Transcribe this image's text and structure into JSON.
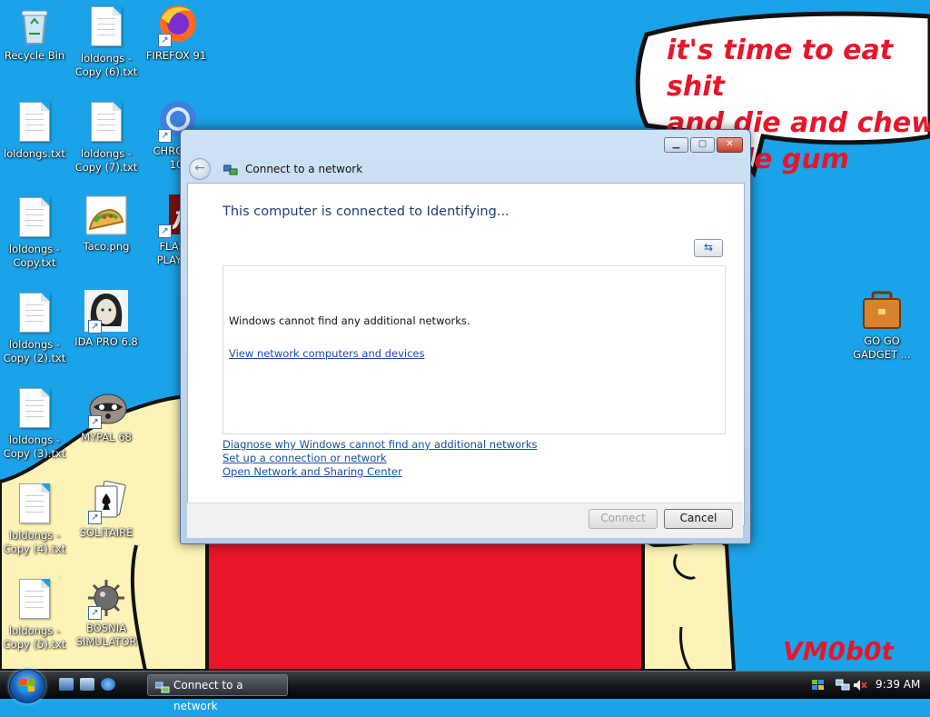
{
  "wallpaper": {
    "speech_text": "it's time to eat shit\nand die and chew\nbubble gum",
    "signature": "VM0b0t",
    "colors": {
      "sky": "#1aa3e8",
      "accent_red": "#e8152b",
      "skin": "#fdf3b6"
    }
  },
  "desktop": {
    "icons": [
      {
        "label": "Recycle Bin",
        "icon": "recycle-bin-icon"
      },
      {
        "label": "loldongs -\nCopy (6).txt",
        "icon": "text-file-icon"
      },
      {
        "label": "FIREFOX 91",
        "icon": "firefox-icon"
      },
      {
        "label": "loldongs.txt",
        "icon": "text-file-icon"
      },
      {
        "label": "loldongs -\nCopy (7).txt",
        "icon": "text-file-icon"
      },
      {
        "label": "CHROME\n10",
        "icon": "chrome-icon"
      },
      {
        "label": "loldongs -\nCopy.txt",
        "icon": "text-file-icon"
      },
      {
        "label": "Taco.png",
        "icon": "taco-image-icon"
      },
      {
        "label": "FLASH\nPLAYER",
        "icon": "flash-player-icon"
      },
      {
        "label": "loldongs -\nCopy (2).txt",
        "icon": "text-file-icon"
      },
      {
        "label": "IDA PRO 6.8",
        "icon": "ida-pro-icon"
      },
      {
        "label": "loldongs -\nCopy (3).txt",
        "icon": "text-file-icon"
      },
      {
        "label": "MYPAL 68",
        "icon": "mypal-raccoon-icon"
      },
      {
        "label": "loldongs -\nCopy (4).txt",
        "icon": "text-file-icon"
      },
      {
        "label": "SOLITAIRE",
        "icon": "solitaire-icon"
      },
      {
        "label": "loldongs -\nCopy (5).txt",
        "icon": "text-file-icon"
      },
      {
        "label": "BOSNIA\nSIMULATOR",
        "icon": "minesweeper-mine-icon"
      },
      {
        "label": "GO GO\nGADGET ...",
        "icon": "briefcase-icon"
      }
    ]
  },
  "dialog": {
    "title": "Connect to a network",
    "heading": "This computer is connected to Identifying...",
    "status_message": "Windows cannot find any additional networks.",
    "view_link": "View network computers and devices",
    "links": [
      "Diagnose why Windows cannot find any additional networks",
      "Set up a connection or network",
      "Open Network and Sharing Center"
    ],
    "connect_label": "Connect",
    "cancel_label": "Cancel"
  },
  "taskbar": {
    "task_title": "Connect to a network",
    "clock": "9:39 AM"
  }
}
